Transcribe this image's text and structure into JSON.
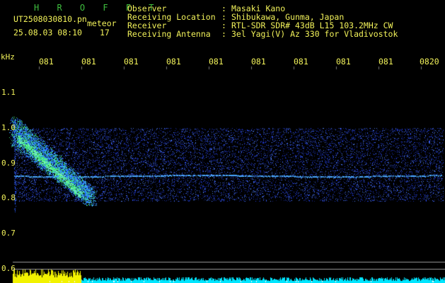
{
  "header": {
    "brand": "H R O F F T",
    "filename": "UT2508030810.pn",
    "suffix": "meteor",
    "datetime": "25.08.03 08:10",
    "count": "17"
  },
  "info": {
    "rows": [
      {
        "label": "Observer",
        "sep": ":",
        "value": "Masaki Kano"
      },
      {
        "label": "Receiving Location",
        "sep": ":",
        "value": "Shibukawa, Gunma, Japan"
      },
      {
        "label": "Receiver",
        "sep": ":",
        "value": "RTL-SDR SDR# 43dB L15 103.2MHz CW"
      },
      {
        "label": "Receiving Antenna",
        "sep": ":",
        "value": "3el Yagi(V) Az 330 for Vladivostok"
      }
    ]
  },
  "axis": {
    "unit": "kHz",
    "y_ticks": [
      "1.1",
      "1.0",
      "0.9",
      "0.8",
      "0.7",
      "0.6"
    ],
    "x_ticks": [
      "081",
      "081",
      "081",
      "081",
      "081",
      "081",
      "081",
      "081",
      "081",
      "0820"
    ]
  },
  "colors": {
    "text": "#f2f25a",
    "brand": "#3fbf3f",
    "noise": "#1a3cff",
    "carrier": "#4aa8ff",
    "echo": "#3fe07a",
    "power_yellow": "#f2f200",
    "power_cyan": "#00e5ff"
  }
}
